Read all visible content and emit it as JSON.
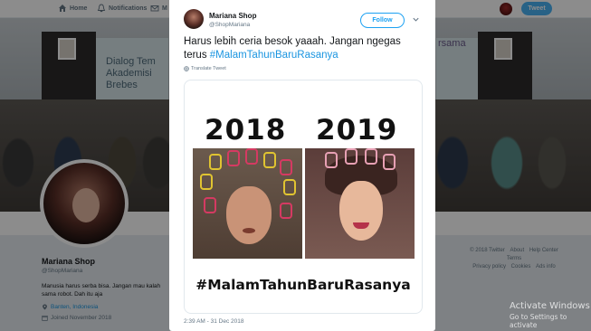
{
  "nav": {
    "home": "Home",
    "notifications": "Notifications",
    "messages": "M",
    "tweet_button": "Tweet"
  },
  "banner": {
    "sign_left": "Dialog Tem\nAkademisi\nBrebes",
    "sign_right": "rsama"
  },
  "profile": {
    "name": "Mariana Shop",
    "handle": "@ShopMariana",
    "bio": "Manusia harus serba bisa. Jangan mau kalah sama robot. Dah itu aja",
    "location": "Banten, Indonesia",
    "joined": "Joined November 2018"
  },
  "footer": {
    "row1": [
      "© 2018 Twitter",
      "About",
      "Help Center",
      "Terms"
    ],
    "row2": [
      "Privacy policy",
      "Cookies",
      "Ads info"
    ]
  },
  "watermark": {
    "line1": "Activate Windows",
    "line2": "Go to Settings to activate"
  },
  "tweet": {
    "author_name": "Mariana Shop",
    "author_handle": "@ShopMariana",
    "follow_label": "Follow",
    "text_plain": "Harus lebih ceria besok yaaah. Jangan ngegas terus ",
    "text_hashtag": "#MalamTahunBaruRasanya",
    "translate_label": "Translate Tweet",
    "timestamp": "2:39 AM - 31 Dec 2018",
    "media": {
      "year_left": "2018",
      "year_right": "2019",
      "hashtag": "#MalamTahunBaruRasanya"
    }
  },
  "colors": {
    "accent": "#1da1f2",
    "link": "#1b95e0",
    "tweet_button": "#4ab3f4"
  },
  "icons": {
    "home": "home-icon",
    "notifications": "bell-icon",
    "messages": "envelope-icon",
    "location": "map-pin-icon",
    "joined": "calendar-icon",
    "translate": "globe-icon",
    "caret": "chevron-down-icon"
  }
}
